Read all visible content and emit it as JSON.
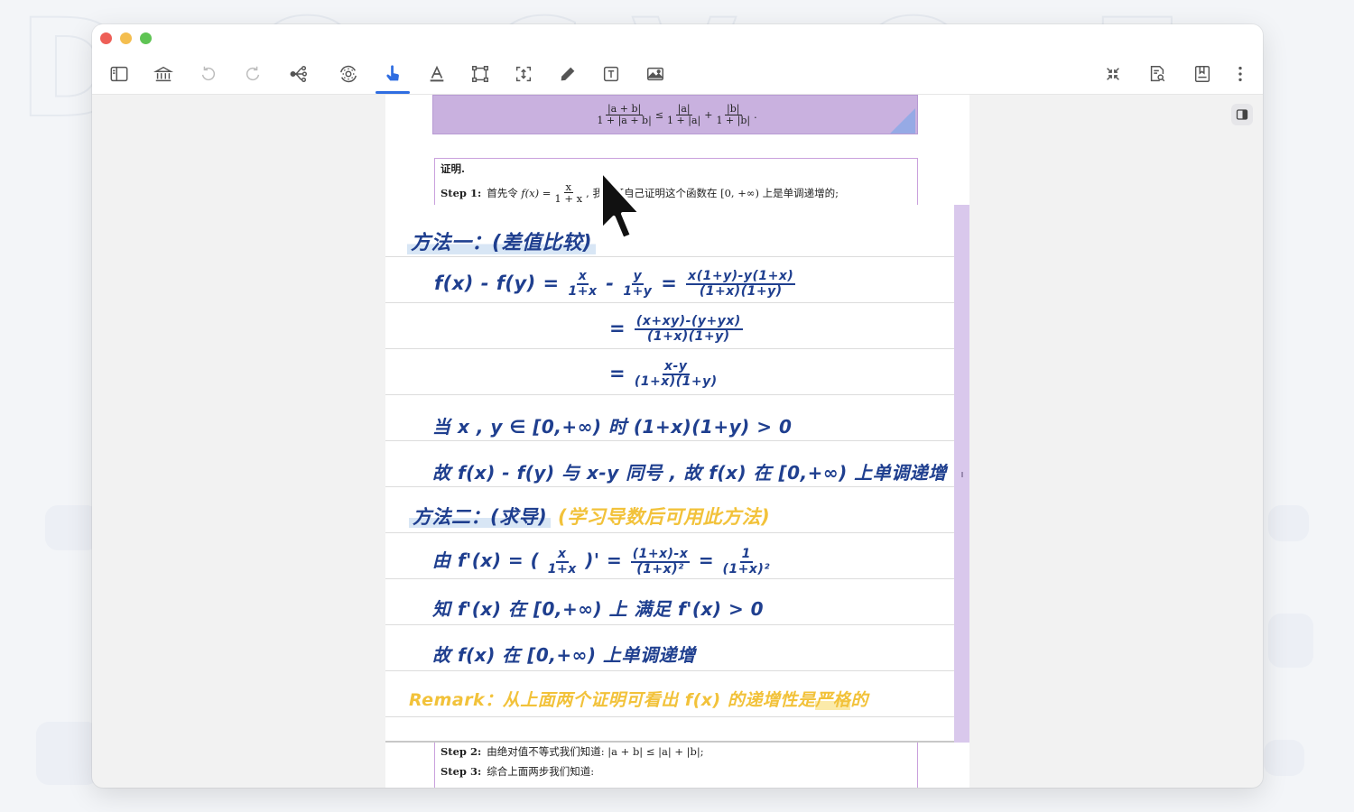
{
  "window": {
    "traffic_lights": {
      "close": "#ee5f57",
      "minimize": "#f4be4f",
      "zoom": "#5fc454"
    }
  },
  "toolbar": {
    "left_tools": [
      {
        "name": "sidebar",
        "icon": "sidebar-icon"
      },
      {
        "name": "library",
        "icon": "library-icon"
      },
      {
        "name": "undo",
        "icon": "undo-icon",
        "enabled": false
      },
      {
        "name": "redo",
        "icon": "redo-icon",
        "enabled": false
      },
      {
        "name": "mindmap",
        "icon": "mindmap-icon"
      },
      {
        "name": "settings",
        "icon": "gear-sync-icon"
      },
      {
        "name": "pointer",
        "icon": "hand-pointer-icon",
        "active": true
      },
      {
        "name": "text-highlight",
        "icon": "text-highlight-icon"
      },
      {
        "name": "crop",
        "icon": "crop-frame-icon"
      },
      {
        "name": "resize",
        "icon": "resize-arrows-icon"
      },
      {
        "name": "pen",
        "icon": "pen-icon"
      },
      {
        "name": "textbox",
        "icon": "textbox-icon"
      },
      {
        "name": "image",
        "icon": "image-icon"
      }
    ],
    "right_tools": [
      {
        "name": "collapse",
        "icon": "collapse-icon"
      },
      {
        "name": "search-document",
        "icon": "document-search-icon"
      },
      {
        "name": "bookmark",
        "icon": "bookmark-icon"
      },
      {
        "name": "more",
        "icon": "more-vertical-icon"
      }
    ],
    "accent_color": "#2f6de1"
  },
  "document": {
    "inequality": {
      "lhs_num": "|a + b|",
      "lhs_den": "1 + |a + b|",
      "op": "≤",
      "t1_num": "|a|",
      "t1_den": "1 + |a|",
      "plus": "+",
      "t2_num": "|b|",
      "t2_den": "1 + |b|",
      "end": "."
    },
    "proof_label": "证明.",
    "step1_label": "Step 1:",
    "step1_pre": "首先令",
    "step1_fx": "f(x) =",
    "step1_num": "x",
    "step1_den": "1 + x",
    "step1_post": ", 我们可自己证明这个函数在 [0, +∞) 上是单调递增的;",
    "step2_label": "Step 2:",
    "step2_text": "由绝对值不等式我们知道: |a + b| ≤ |a| + |b|;",
    "step3_label": "Step 3:",
    "step3_text": "综合上面两步我们知道:"
  },
  "notes": {
    "method1_title": "方法一：(差值比较)",
    "line1_lhs": "f(x) - f(y) =",
    "line1_f1_n": "x",
    "line1_f1_d": "1+x",
    "line1_minus": "-",
    "line1_f2_n": "y",
    "line1_f2_d": "1+y",
    "line1_eq": "=",
    "line1_f3_n": "x(1+y)-y(1+x)",
    "line1_f3_d": "(1+x)(1+y)",
    "line2_eq": "=",
    "line2_n": "(x+xy)-(y+yx)",
    "line2_d": "(1+x)(1+y)",
    "line3_eq": "=",
    "line3_n": "x-y",
    "line3_d": "(1+x)(1+y)",
    "line4": "当 x , y ∈ [0,+∞) 时  (1+x)(1+y) > 0",
    "line5": "故 f(x) - f(y) 与 x-y 同号 , 故 f(x) 在 [0,+∞) 上单调递增",
    "method2_title": "方法二：(求导)",
    "method2_note": "(学习导数后可用此方法)",
    "line6_pre": "由  f'(x) = (",
    "line6_f1_n": "x",
    "line6_f1_d": "1+x",
    "line6_mid": ")' =",
    "line6_f2_n": "(1+x)-x",
    "line6_f2_d": "(1+x)²",
    "line6_eq": "=",
    "line6_f3_n": "1",
    "line6_f3_d": "(1+x)²",
    "line7": "知  f'(x) 在 [0,+∞) 上 满足 f'(x) > 0",
    "line8": "故  f(x) 在 [0,+∞) 上单调递增",
    "remark_pre": "Remark：从上面两个证明可看出 f(x) 的递增性是",
    "remark_hl": "严格",
    "remark_post": "的",
    "ink_color": "#1f3f8f",
    "highlight_color": "#f2c23a"
  }
}
